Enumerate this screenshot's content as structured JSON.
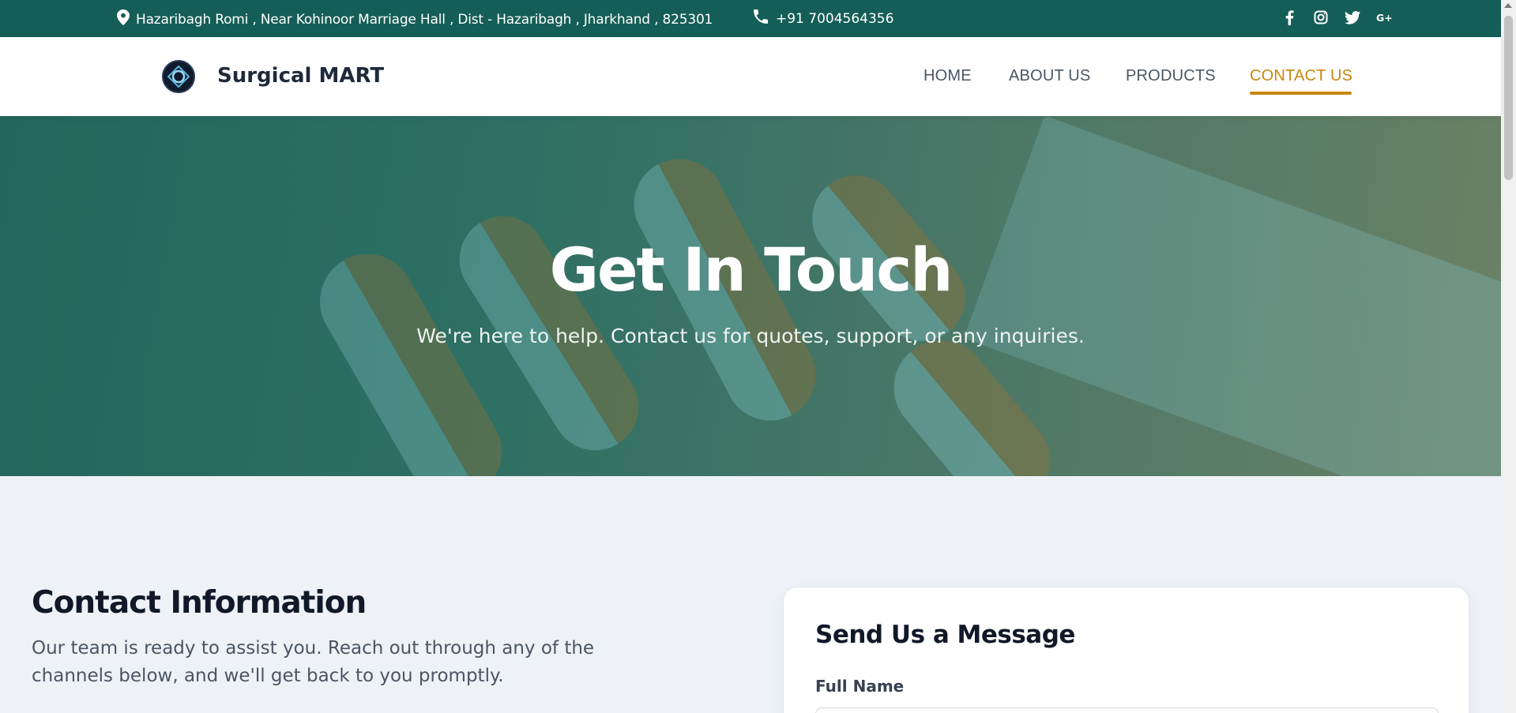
{
  "topbar": {
    "address": "Hazaribagh Romi , Near Kohinoor Marriage Hall , Dist - Hazaribagh , Jharkhand , 825301",
    "phone": "+91 7004564356",
    "social_icons": [
      "facebook-icon",
      "instagram-icon",
      "twitter-icon",
      "google-plus-icon"
    ],
    "bg_color": "#155e57"
  },
  "nav": {
    "brand": "Surgical MART",
    "items": [
      {
        "label": "HOME"
      },
      {
        "label": "ABOUT US"
      },
      {
        "label": "PRODUCTS"
      },
      {
        "label": "CONTACT US",
        "active": true
      }
    ],
    "accent_color": "#c8860d"
  },
  "hero": {
    "title": "Get In Touch",
    "subtitle": "We're here to help. Contact us for quotes, support, or any inquiries."
  },
  "contact_info": {
    "title": "Contact Information",
    "description": "Our team is ready to assist you. Reach out through any of the channels below, and we'll get back to you promptly."
  },
  "form": {
    "title": "Send Us a Message",
    "full_name_label": "Full Name",
    "full_name_value": ""
  }
}
